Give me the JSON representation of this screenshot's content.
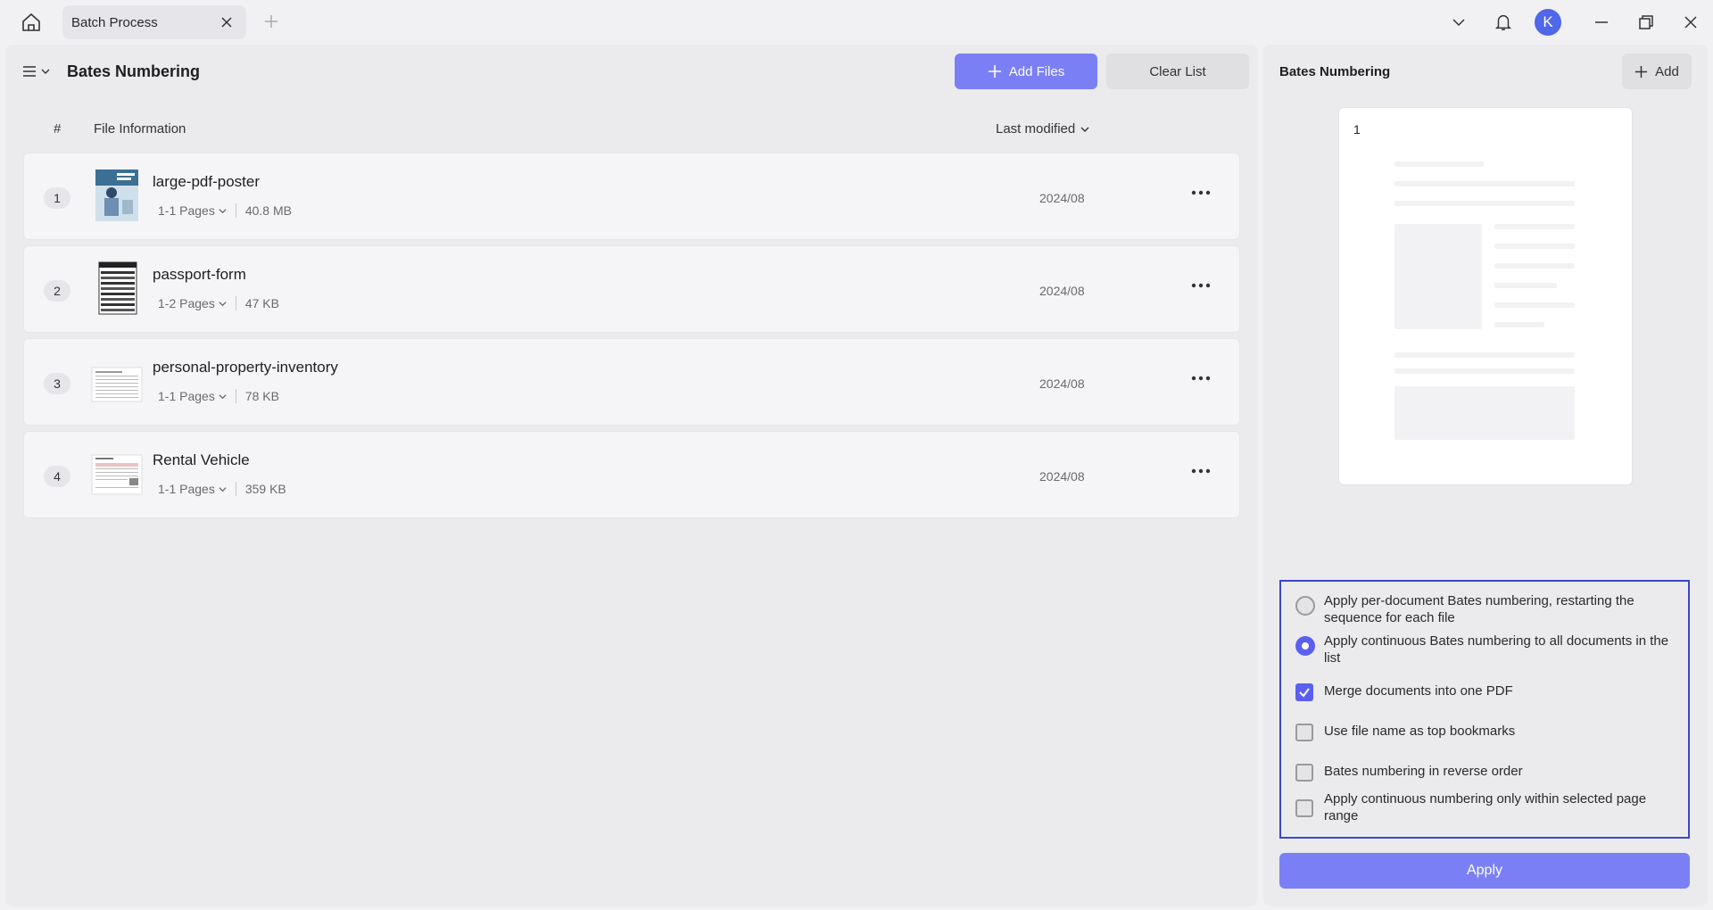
{
  "titlebar": {
    "tab_label": "Batch Process",
    "avatar_letter": "K"
  },
  "left_panel": {
    "title": "Bates Numbering",
    "add_files_label": "Add Files",
    "clear_list_label": "Clear List",
    "columns": {
      "index": "#",
      "info": "File Information",
      "sort": "Last modified"
    },
    "files": [
      {
        "num": "1",
        "name": "large-pdf-poster",
        "pages": "1-1 Pages",
        "size": "40.8 MB",
        "date": "2024/08",
        "thumb": "poster-thumbnail"
      },
      {
        "num": "2",
        "name": "passport-form",
        "pages": "1-2 Pages",
        "size": "47 KB",
        "date": "2024/08",
        "thumb": "form-thumbnail"
      },
      {
        "num": "3",
        "name": "personal-property-inventory",
        "pages": "1-1 Pages",
        "size": "78 KB",
        "date": "2024/08",
        "thumb": "document-thumbnail"
      },
      {
        "num": "4",
        "name": "Rental Vehicle",
        "pages": "1-1 Pages",
        "size": "359 KB",
        "date": "2024/08",
        "thumb": "document-thumbnail"
      }
    ]
  },
  "right_panel": {
    "title": "Bates Numbering",
    "add_label": "Add",
    "preview_number": "1",
    "options": {
      "opt1": "Apply per-document Bates numbering, restarting the sequence for each file",
      "opt2": "Apply continuous Bates numbering to all documents in the list",
      "opt3": "Merge documents into one PDF",
      "opt4": "Use file name as top bookmarks",
      "opt5": "Bates numbering in reverse order",
      "opt6": "Apply continuous numbering only within selected page range"
    },
    "apply_label": "Apply"
  },
  "colors": {
    "accent": "#7b7ff6",
    "accent_strong": "#5b5ff0",
    "highlight_border": "#3a47c9"
  }
}
